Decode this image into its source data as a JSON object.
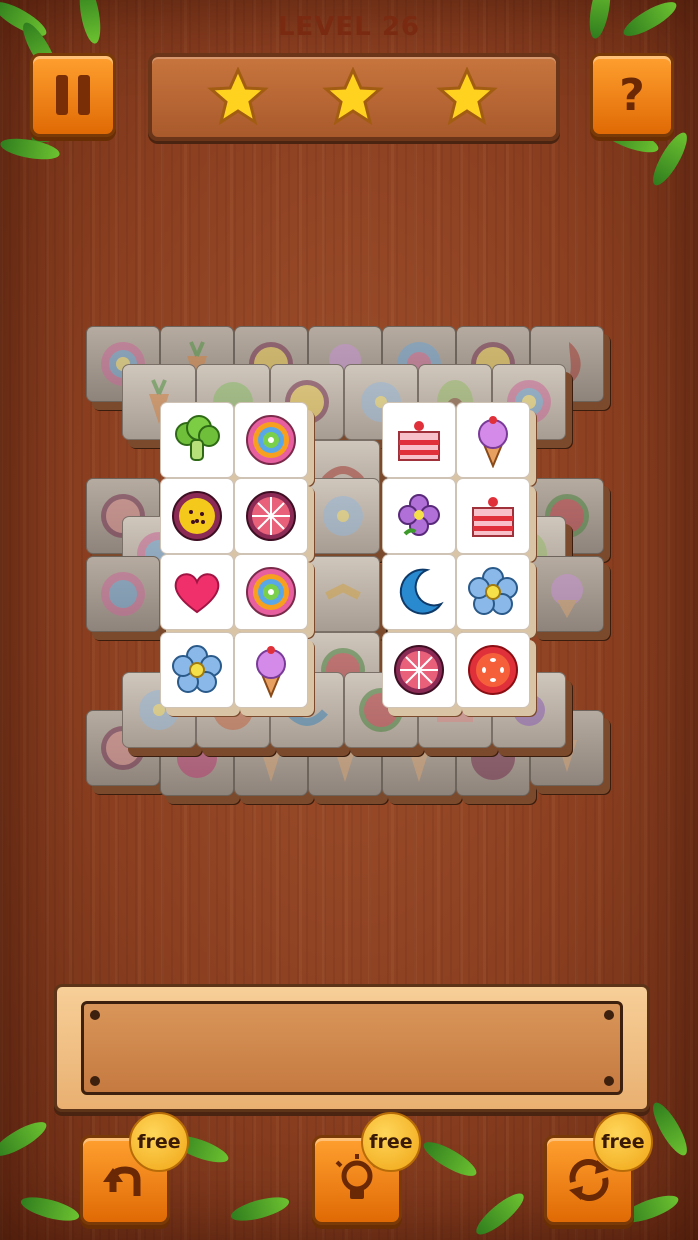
{
  "header": {
    "level_label": "LEVEL 26",
    "stars_earned": 3,
    "stars_total": 3
  },
  "buttons": {
    "pause_icon": "pause-icon",
    "help_icon": "question-icon"
  },
  "board": {
    "tile_face_icons": [
      "broccoli-icon",
      "swirl-candy-icon",
      "cake-slice-icon",
      "ice-cream-icon",
      "passion-fruit-icon",
      "grapefruit-icon",
      "purple-flower-icon",
      "cake-slice-icon",
      "heart-icon",
      "swirl-candy-icon",
      "moon-icon",
      "blue-flower-icon",
      "blue-flower-icon",
      "ice-cream-icon",
      "grapefruit-icon",
      "tomato-slice-icon"
    ]
  },
  "tools": [
    {
      "name": "undo",
      "icon": "undo-icon",
      "badge": "free"
    },
    {
      "name": "hint",
      "icon": "lightbulb-icon",
      "badge": "free"
    },
    {
      "name": "shuffle",
      "icon": "shuffle-icon",
      "badge": "free"
    }
  ],
  "colors": {
    "button_orange": "#f08a1a",
    "wood": "#8b3f20",
    "star_gold": "#ffd21f"
  }
}
